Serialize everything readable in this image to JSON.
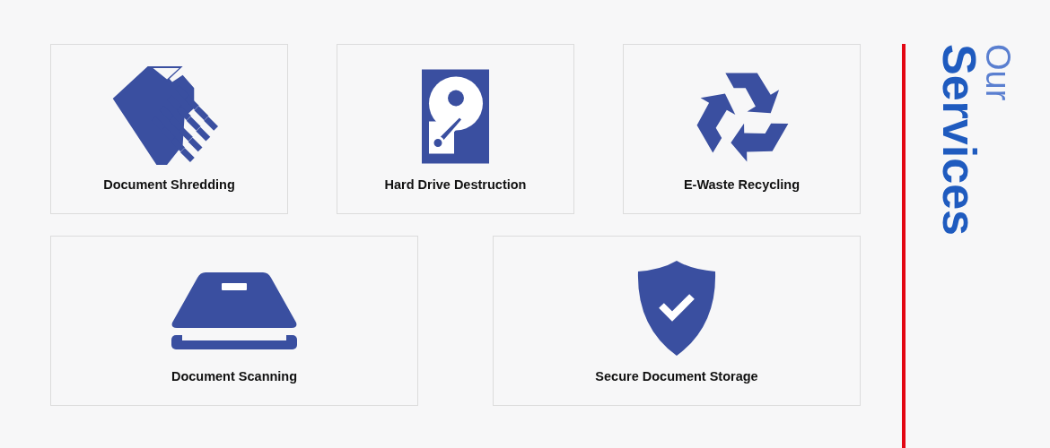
{
  "services": [
    {
      "label": "Document Shredding"
    },
    {
      "label": "Hard Drive Destruction"
    },
    {
      "label": "E-Waste Recycling"
    },
    {
      "label": "Document Scanning"
    },
    {
      "label": "Secure Document Storage"
    }
  ],
  "heading": {
    "prefix": "Our",
    "title": "Services"
  }
}
